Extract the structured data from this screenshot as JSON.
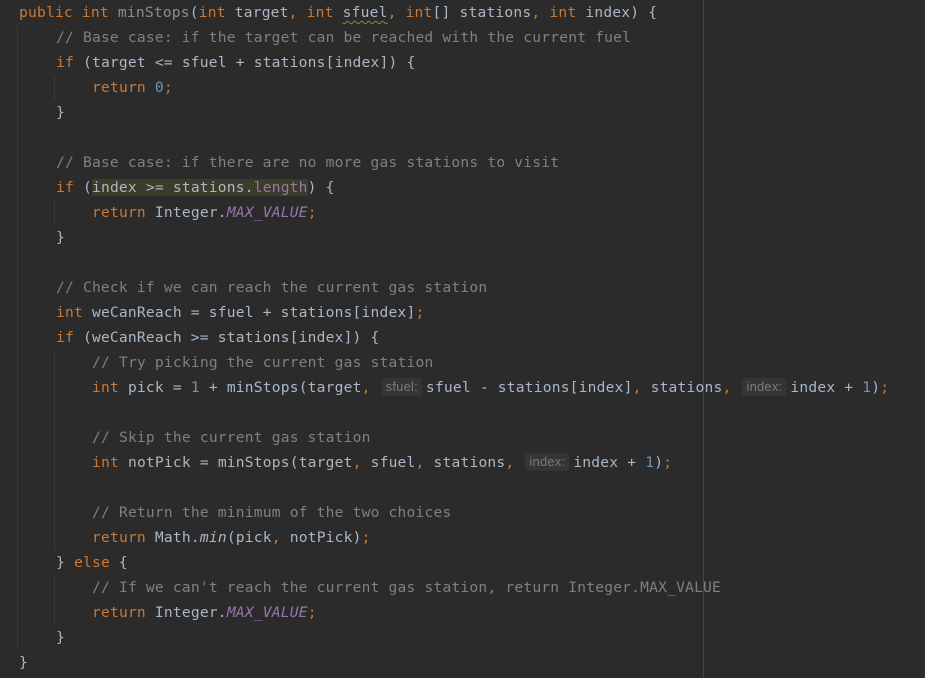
{
  "editor": {
    "theme": {
      "background": "#2b2b2b",
      "keyword": "#cc7832",
      "text": "#a9b7c6",
      "comment": "#808080",
      "number": "#6897bb",
      "constant": "#9876aa"
    },
    "lines": [
      {
        "kw1": "public",
        "kw2": "int",
        "method": "minStops",
        "p1": "(",
        "kw3": "int",
        "t1": " target",
        "c1": ",",
        "kw4": "int",
        "t2": "sfuel",
        "c2": ",",
        "kw5": "int",
        "t3": "[] stations",
        "c3": ",",
        "kw6": "int",
        "t4": " index) {"
      },
      {
        "comment": "// Base case: if the target can be reached with the current fuel"
      },
      {
        "kw": "if",
        "text": " (target <= sfuel + stations[index]) {"
      },
      {
        "kw": "return",
        "num": "0",
        "semi": ";"
      },
      {
        "text": "}"
      },
      {
        "text": ""
      },
      {
        "comment": "// Base case: if there are no more gas stations to visit"
      },
      {
        "kw": "if",
        "pre": " (",
        "hl_a": "index >= stations.",
        "hl_field": "length",
        "post": ") {"
      },
      {
        "kw": "return",
        "text": " Integer.",
        "const": "MAX_VALUE",
        "semi": ";"
      },
      {
        "text": "}"
      },
      {
        "text": ""
      },
      {
        "comment": "// Check if we can reach the current gas station"
      },
      {
        "kw": "int",
        "text": " weCanReach = sfuel + stations[index]",
        "semi": ";"
      },
      {
        "kw": "if",
        "text": " (weCanReach >= stations[index]) {"
      },
      {
        "comment": "// Try picking the current gas station"
      },
      {
        "kw": "int",
        "t1": " pick = ",
        "n1": "1",
        "t2": " + minStops(target",
        "c1": ",",
        "hint1": "sfuel:",
        "t3": "sfuel - stations[index]",
        "c2": ",",
        "t4": " stations",
        "c3": ",",
        "hint2": "index:",
        "t5": "index + ",
        "n2": "1",
        "t6": ")",
        "semi": ";"
      },
      {
        "text": ""
      },
      {
        "comment": "// Skip the current gas station"
      },
      {
        "kw": "int",
        "t1": " notPick = minStops(target",
        "c1": ",",
        "t2": " sfuel",
        "c2": ",",
        "t3": " stations",
        "c3": ",",
        "hint": "index:",
        "t4": "index + ",
        "n": "1",
        "t5": ")",
        "semi": ";"
      },
      {
        "text": ""
      },
      {
        "comment": "// Return the minimum of the two choices"
      },
      {
        "kw": "return",
        "t1": " Math.",
        "method": "min",
        "t2": "(pick",
        "c1": ",",
        "t3": " notPick)",
        "semi": ";"
      },
      {
        "t1": "} ",
        "kw": "else",
        "t2": " {"
      },
      {
        "comment": "// If we can't reach the current gas station, return Integer.MAX_VALUE"
      },
      {
        "kw": "return",
        "text": " Integer.",
        "const": "MAX_VALUE",
        "semi": ";"
      },
      {
        "text": "}"
      },
      {
        "text": "}"
      }
    ]
  }
}
